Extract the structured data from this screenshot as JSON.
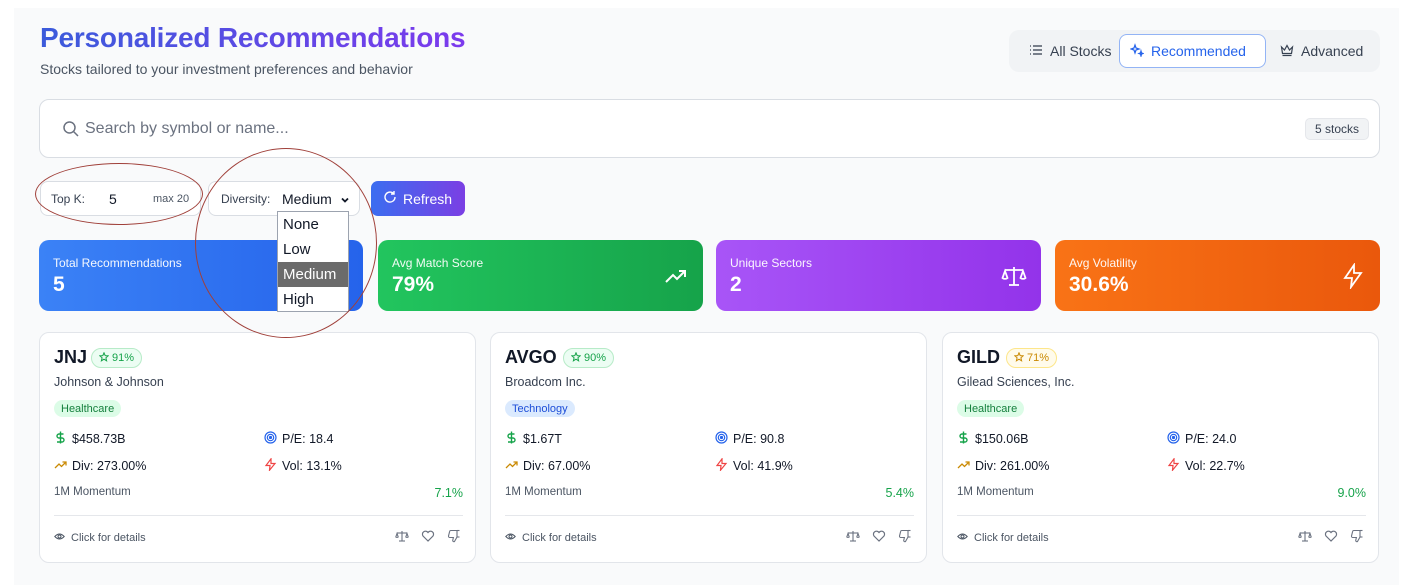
{
  "header": {
    "title": "Personalized Recommendations",
    "subtitle": "Stocks tailored to your investment preferences and behavior"
  },
  "view_tabs": [
    {
      "label": "All Stocks",
      "icon": "list-icon",
      "active": false
    },
    {
      "label": "Recommended",
      "icon": "sparkles-icon",
      "active": true
    },
    {
      "label": "Advanced",
      "icon": "crown-icon",
      "active": false
    }
  ],
  "search": {
    "placeholder": "Search by symbol or name...",
    "value": "",
    "count_badge": "5 stocks"
  },
  "controls": {
    "top_k_label": "Top K:",
    "top_k_value": "5",
    "top_k_max": "max 20",
    "diversity_label": "Diversity:",
    "diversity_value": "Medium",
    "diversity_options": [
      "None",
      "Low",
      "Medium",
      "High"
    ],
    "refresh_label": "Refresh"
  },
  "stats": [
    {
      "label": "Total Recommendations",
      "value": "5",
      "icon": "none"
    },
    {
      "label": "Avg Match Score",
      "value": "79%",
      "icon": "trending-up-icon"
    },
    {
      "label": "Unique Sectors",
      "value": "2",
      "icon": "scale-icon"
    },
    {
      "label": "Avg Volatility",
      "value": "30.6%",
      "icon": "zap-icon"
    }
  ],
  "colors": {
    "accent": "#2563eb",
    "positive": "#16a34a",
    "warning": "#ca8a04",
    "danger": "#ef4444",
    "annotation_ring": "#a0403a"
  },
  "cards": [
    {
      "symbol": "JNJ",
      "score": "91%",
      "score_tone": "green",
      "name": "Johnson & Johnson",
      "sector": "Healthcare",
      "market_cap": "$458.73B",
      "pe": "P/E: 18.4",
      "dividend": "Div: 273.00%",
      "volatility": "Vol: 13.1%",
      "momentum_label": "1M Momentum",
      "momentum_value": "7.1%",
      "details_label": "Click for details"
    },
    {
      "symbol": "AVGO",
      "score": "90%",
      "score_tone": "green",
      "name": "Broadcom Inc.",
      "sector": "Technology",
      "market_cap": "$1.67T",
      "pe": "P/E: 90.8",
      "dividend": "Div: 67.00%",
      "volatility": "Vol: 41.9%",
      "momentum_label": "1M Momentum",
      "momentum_value": "5.4%",
      "details_label": "Click for details"
    },
    {
      "symbol": "GILD",
      "score": "71%",
      "score_tone": "yellow",
      "name": "Gilead Sciences, Inc.",
      "sector": "Healthcare",
      "market_cap": "$150.06B",
      "pe": "P/E: 24.0",
      "dividend": "Div: 261.00%",
      "volatility": "Vol: 22.7%",
      "momentum_label": "1M Momentum",
      "momentum_value": "9.0%",
      "details_label": "Click for details"
    }
  ]
}
